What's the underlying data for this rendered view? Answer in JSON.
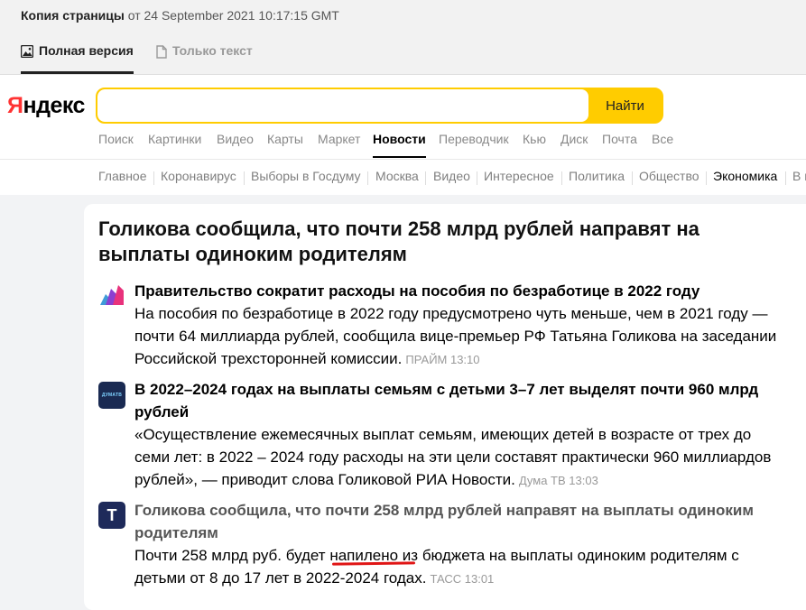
{
  "cache": {
    "title_bold": "Копия страницы",
    "title_rest": " от 24 September 2021 10:17:15 GMT",
    "tabs": [
      {
        "label": "Полная версия",
        "icon": "image-icon",
        "active": true
      },
      {
        "label": "Только текст",
        "icon": "document-icon",
        "active": false
      }
    ]
  },
  "yandex": {
    "logo_first": "Я",
    "logo_rest": "ндекс",
    "search_placeholder": "",
    "search_button": "Найти",
    "services": [
      "Поиск",
      "Картинки",
      "Видео",
      "Карты",
      "Маркет",
      "Новости",
      "Переводчик",
      "Кью",
      "Диск",
      "Почта",
      "Все"
    ],
    "active_service": "Новости",
    "rubrics": [
      "Главное",
      "Коронавирус",
      "Выборы в Госдуму",
      "Москва",
      "Видео",
      "Интересное",
      "Политика",
      "Общество",
      "Экономика",
      "В м"
    ],
    "active_rubric": "Экономика"
  },
  "story": {
    "title": "Голикова сообщила, что почти 258 млрд рублей направят на выплаты одиноким родителям",
    "items": [
      {
        "icon": "prime-logo-icon",
        "title": "Правительство сократит расходы на пособия по безработице в 2022 году",
        "text": "На пособия по безработице в 2022 году предусмотрено чуть меньше, чем в 2021 году — почти 64 миллиарда рублей, сообщила вице-премьер РФ Татьяна Голикова на заседании Российской трехсторонней комиссии.",
        "source": "ПРАЙМ 13:10"
      },
      {
        "icon": "dumatv-logo-icon",
        "icon_text": "ДУМАТВ",
        "title": "В 2022–2024 годах на выплаты семьям с детьми 3–7 лет выделят почти 960 млрд рублей",
        "text": "«Осуществление ежемесячных выплат семьям, имеющих детей в возрасте от трех до семи лет: в 2022 – 2024 году расходы на эти цели составят практически 960 миллиардов рублей», — приводит слова Голиковой РИА Новости.",
        "source": "Дума ТВ 13:03"
      },
      {
        "icon": "tass-logo-icon",
        "icon_text": "Т",
        "title": "Голикова сообщила, что почти 258 млрд рублей направят на выплаты одиноким родителям",
        "text": "Почти 258 млрд руб. будет напилено из бюджета на выплаты одиноким родителям с детьми от 8 до 17 лет в 2022-2024 годах.",
        "source": "ТАСС 13:01"
      }
    ]
  },
  "colors": {
    "yandex_red": "#ff3333",
    "search_yellow": "#ffcc00",
    "prime_purple": "#8b3fd1",
    "prime_pink": "#e8327c",
    "dumatv_navy": "#1a2a52",
    "tass_navy": "#1e2a5a",
    "underline_red": "#e01515"
  }
}
